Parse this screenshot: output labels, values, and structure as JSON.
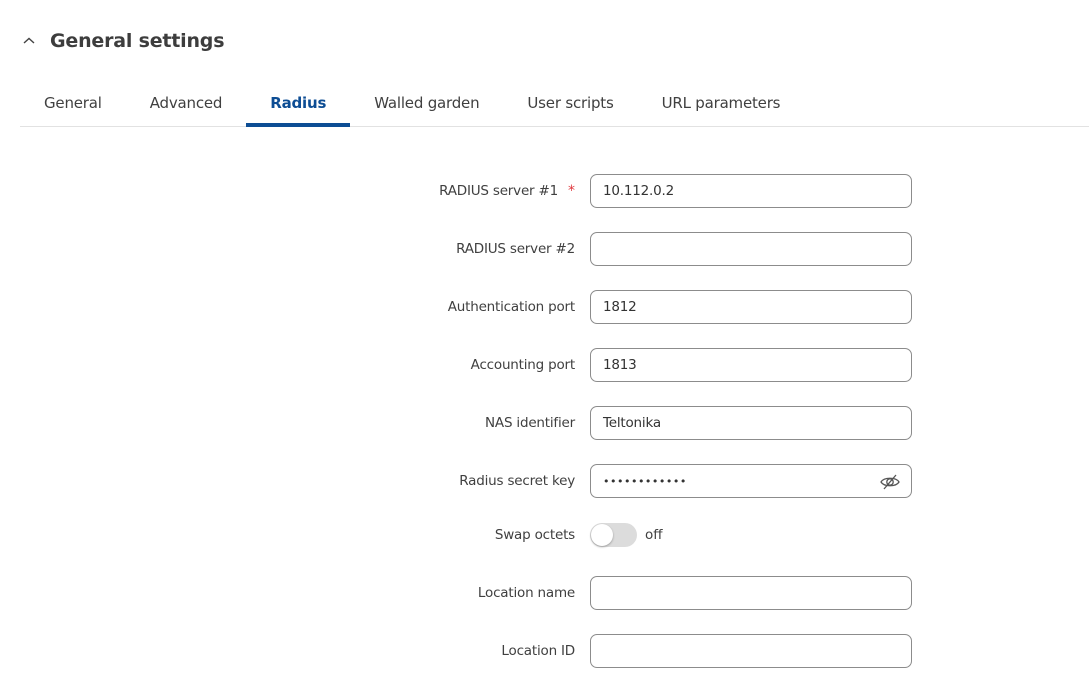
{
  "section": {
    "title": "General settings",
    "collapse_icon": "chevron-up-icon"
  },
  "tabs": [
    {
      "label": "General",
      "active": false
    },
    {
      "label": "Advanced",
      "active": false
    },
    {
      "label": "Radius",
      "active": true
    },
    {
      "label": "Walled garden",
      "active": false
    },
    {
      "label": "User scripts",
      "active": false
    },
    {
      "label": "URL parameters",
      "active": false
    }
  ],
  "form": {
    "radius_server_1": {
      "label": "RADIUS server #1",
      "required": true,
      "required_mark": "*",
      "value": "10.112.0.2"
    },
    "radius_server_2": {
      "label": "RADIUS server #2",
      "value": ""
    },
    "auth_port": {
      "label": "Authentication port",
      "value": "1812"
    },
    "acct_port": {
      "label": "Accounting port",
      "value": "1813"
    },
    "nas_identifier": {
      "label": "NAS identifier",
      "value": "Teltonika"
    },
    "secret_key": {
      "label": "Radius secret key",
      "masked_value": "••••••••••••",
      "toggle_icon": "eye-slash-icon"
    },
    "swap_octets": {
      "label": "Swap octets",
      "state": "off",
      "enabled": false
    },
    "location_name": {
      "label": "Location name",
      "value": ""
    },
    "location_id": {
      "label": "Location ID",
      "value": ""
    }
  },
  "colors": {
    "accent": "#0d4d94",
    "required": "#e0393e",
    "toggle_off": "#dcdcdc"
  }
}
